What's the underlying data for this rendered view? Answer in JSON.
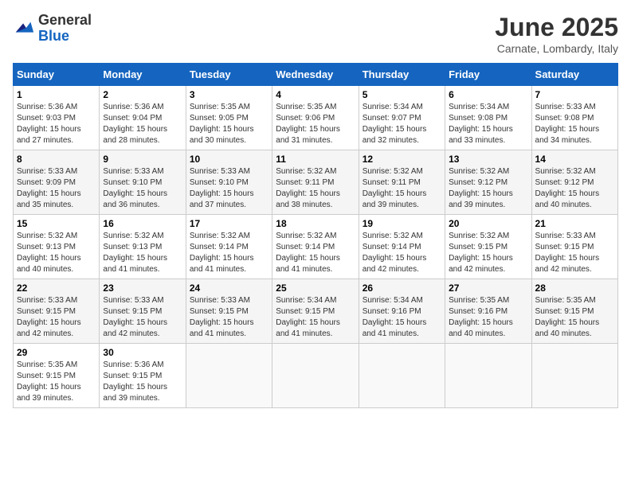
{
  "header": {
    "logo_general": "General",
    "logo_blue": "Blue",
    "title": "June 2025",
    "subtitle": "Carnate, Lombardy, Italy"
  },
  "weekdays": [
    "Sunday",
    "Monday",
    "Tuesday",
    "Wednesday",
    "Thursday",
    "Friday",
    "Saturday"
  ],
  "weeks": [
    [
      {
        "day": "1",
        "sunrise": "Sunrise: 5:36 AM",
        "sunset": "Sunset: 9:03 PM",
        "daylight": "Daylight: 15 hours and 27 minutes."
      },
      {
        "day": "2",
        "sunrise": "Sunrise: 5:36 AM",
        "sunset": "Sunset: 9:04 PM",
        "daylight": "Daylight: 15 hours and 28 minutes."
      },
      {
        "day": "3",
        "sunrise": "Sunrise: 5:35 AM",
        "sunset": "Sunset: 9:05 PM",
        "daylight": "Daylight: 15 hours and 30 minutes."
      },
      {
        "day": "4",
        "sunrise": "Sunrise: 5:35 AM",
        "sunset": "Sunset: 9:06 PM",
        "daylight": "Daylight: 15 hours and 31 minutes."
      },
      {
        "day": "5",
        "sunrise": "Sunrise: 5:34 AM",
        "sunset": "Sunset: 9:07 PM",
        "daylight": "Daylight: 15 hours and 32 minutes."
      },
      {
        "day": "6",
        "sunrise": "Sunrise: 5:34 AM",
        "sunset": "Sunset: 9:08 PM",
        "daylight": "Daylight: 15 hours and 33 minutes."
      },
      {
        "day": "7",
        "sunrise": "Sunrise: 5:33 AM",
        "sunset": "Sunset: 9:08 PM",
        "daylight": "Daylight: 15 hours and 34 minutes."
      }
    ],
    [
      {
        "day": "8",
        "sunrise": "Sunrise: 5:33 AM",
        "sunset": "Sunset: 9:09 PM",
        "daylight": "Daylight: 15 hours and 35 minutes."
      },
      {
        "day": "9",
        "sunrise": "Sunrise: 5:33 AM",
        "sunset": "Sunset: 9:10 PM",
        "daylight": "Daylight: 15 hours and 36 minutes."
      },
      {
        "day": "10",
        "sunrise": "Sunrise: 5:33 AM",
        "sunset": "Sunset: 9:10 PM",
        "daylight": "Daylight: 15 hours and 37 minutes."
      },
      {
        "day": "11",
        "sunrise": "Sunrise: 5:32 AM",
        "sunset": "Sunset: 9:11 PM",
        "daylight": "Daylight: 15 hours and 38 minutes."
      },
      {
        "day": "12",
        "sunrise": "Sunrise: 5:32 AM",
        "sunset": "Sunset: 9:11 PM",
        "daylight": "Daylight: 15 hours and 39 minutes."
      },
      {
        "day": "13",
        "sunrise": "Sunrise: 5:32 AM",
        "sunset": "Sunset: 9:12 PM",
        "daylight": "Daylight: 15 hours and 39 minutes."
      },
      {
        "day": "14",
        "sunrise": "Sunrise: 5:32 AM",
        "sunset": "Sunset: 9:12 PM",
        "daylight": "Daylight: 15 hours and 40 minutes."
      }
    ],
    [
      {
        "day": "15",
        "sunrise": "Sunrise: 5:32 AM",
        "sunset": "Sunset: 9:13 PM",
        "daylight": "Daylight: 15 hours and 40 minutes."
      },
      {
        "day": "16",
        "sunrise": "Sunrise: 5:32 AM",
        "sunset": "Sunset: 9:13 PM",
        "daylight": "Daylight: 15 hours and 41 minutes."
      },
      {
        "day": "17",
        "sunrise": "Sunrise: 5:32 AM",
        "sunset": "Sunset: 9:14 PM",
        "daylight": "Daylight: 15 hours and 41 minutes."
      },
      {
        "day": "18",
        "sunrise": "Sunrise: 5:32 AM",
        "sunset": "Sunset: 9:14 PM",
        "daylight": "Daylight: 15 hours and 41 minutes."
      },
      {
        "day": "19",
        "sunrise": "Sunrise: 5:32 AM",
        "sunset": "Sunset: 9:14 PM",
        "daylight": "Daylight: 15 hours and 42 minutes."
      },
      {
        "day": "20",
        "sunrise": "Sunrise: 5:32 AM",
        "sunset": "Sunset: 9:15 PM",
        "daylight": "Daylight: 15 hours and 42 minutes."
      },
      {
        "day": "21",
        "sunrise": "Sunrise: 5:33 AM",
        "sunset": "Sunset: 9:15 PM",
        "daylight": "Daylight: 15 hours and 42 minutes."
      }
    ],
    [
      {
        "day": "22",
        "sunrise": "Sunrise: 5:33 AM",
        "sunset": "Sunset: 9:15 PM",
        "daylight": "Daylight: 15 hours and 42 minutes."
      },
      {
        "day": "23",
        "sunrise": "Sunrise: 5:33 AM",
        "sunset": "Sunset: 9:15 PM",
        "daylight": "Daylight: 15 hours and 42 minutes."
      },
      {
        "day": "24",
        "sunrise": "Sunrise: 5:33 AM",
        "sunset": "Sunset: 9:15 PM",
        "daylight": "Daylight: 15 hours and 41 minutes."
      },
      {
        "day": "25",
        "sunrise": "Sunrise: 5:34 AM",
        "sunset": "Sunset: 9:15 PM",
        "daylight": "Daylight: 15 hours and 41 minutes."
      },
      {
        "day": "26",
        "sunrise": "Sunrise: 5:34 AM",
        "sunset": "Sunset: 9:16 PM",
        "daylight": "Daylight: 15 hours and 41 minutes."
      },
      {
        "day": "27",
        "sunrise": "Sunrise: 5:35 AM",
        "sunset": "Sunset: 9:16 PM",
        "daylight": "Daylight: 15 hours and 40 minutes."
      },
      {
        "day": "28",
        "sunrise": "Sunrise: 5:35 AM",
        "sunset": "Sunset: 9:15 PM",
        "daylight": "Daylight: 15 hours and 40 minutes."
      }
    ],
    [
      {
        "day": "29",
        "sunrise": "Sunrise: 5:35 AM",
        "sunset": "Sunset: 9:15 PM",
        "daylight": "Daylight: 15 hours and 39 minutes."
      },
      {
        "day": "30",
        "sunrise": "Sunrise: 5:36 AM",
        "sunset": "Sunset: 9:15 PM",
        "daylight": "Daylight: 15 hours and 39 minutes."
      },
      null,
      null,
      null,
      null,
      null
    ]
  ]
}
